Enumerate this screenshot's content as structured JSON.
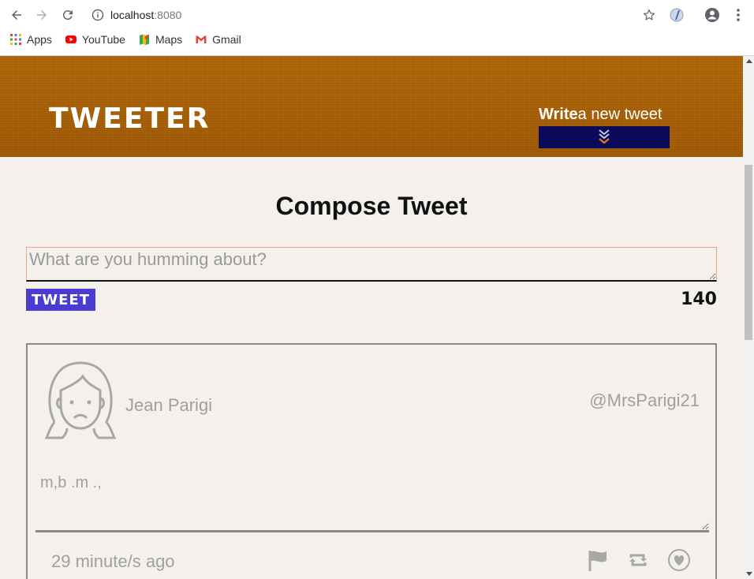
{
  "browser": {
    "url_host": "localhost",
    "url_port": ":8080",
    "bookmarks": [
      {
        "label": "Apps",
        "icon": "apps-grid-icon"
      },
      {
        "label": "YouTube",
        "icon": "youtube-icon"
      },
      {
        "label": "Maps",
        "icon": "maps-icon"
      },
      {
        "label": "Gmail",
        "icon": "gmail-icon"
      }
    ]
  },
  "header": {
    "logo": "TWEETER",
    "write_bold": "Write",
    "write_rest": "a new tweet",
    "toggle_icon": "double-chevron-down-icon"
  },
  "compose": {
    "title": "Compose Tweet",
    "placeholder": "What are you humming about?",
    "button_label": "TWEET",
    "counter": "140"
  },
  "tweet": {
    "name": "Jean Parigi",
    "handle": "@MrsParigi21",
    "body": "m,b .m .,",
    "timestamp": "29 minute/s ago",
    "actions": [
      "flag-icon",
      "retweet-icon",
      "heart-icon"
    ]
  },
  "colors": {
    "header_bg": "#b8680a",
    "toggle_bg": "#0b0a5a",
    "tweet_button_bg": "#4a3bd1",
    "page_bg": "#f4f1ed",
    "chevron_accent": "#e07a1a"
  }
}
